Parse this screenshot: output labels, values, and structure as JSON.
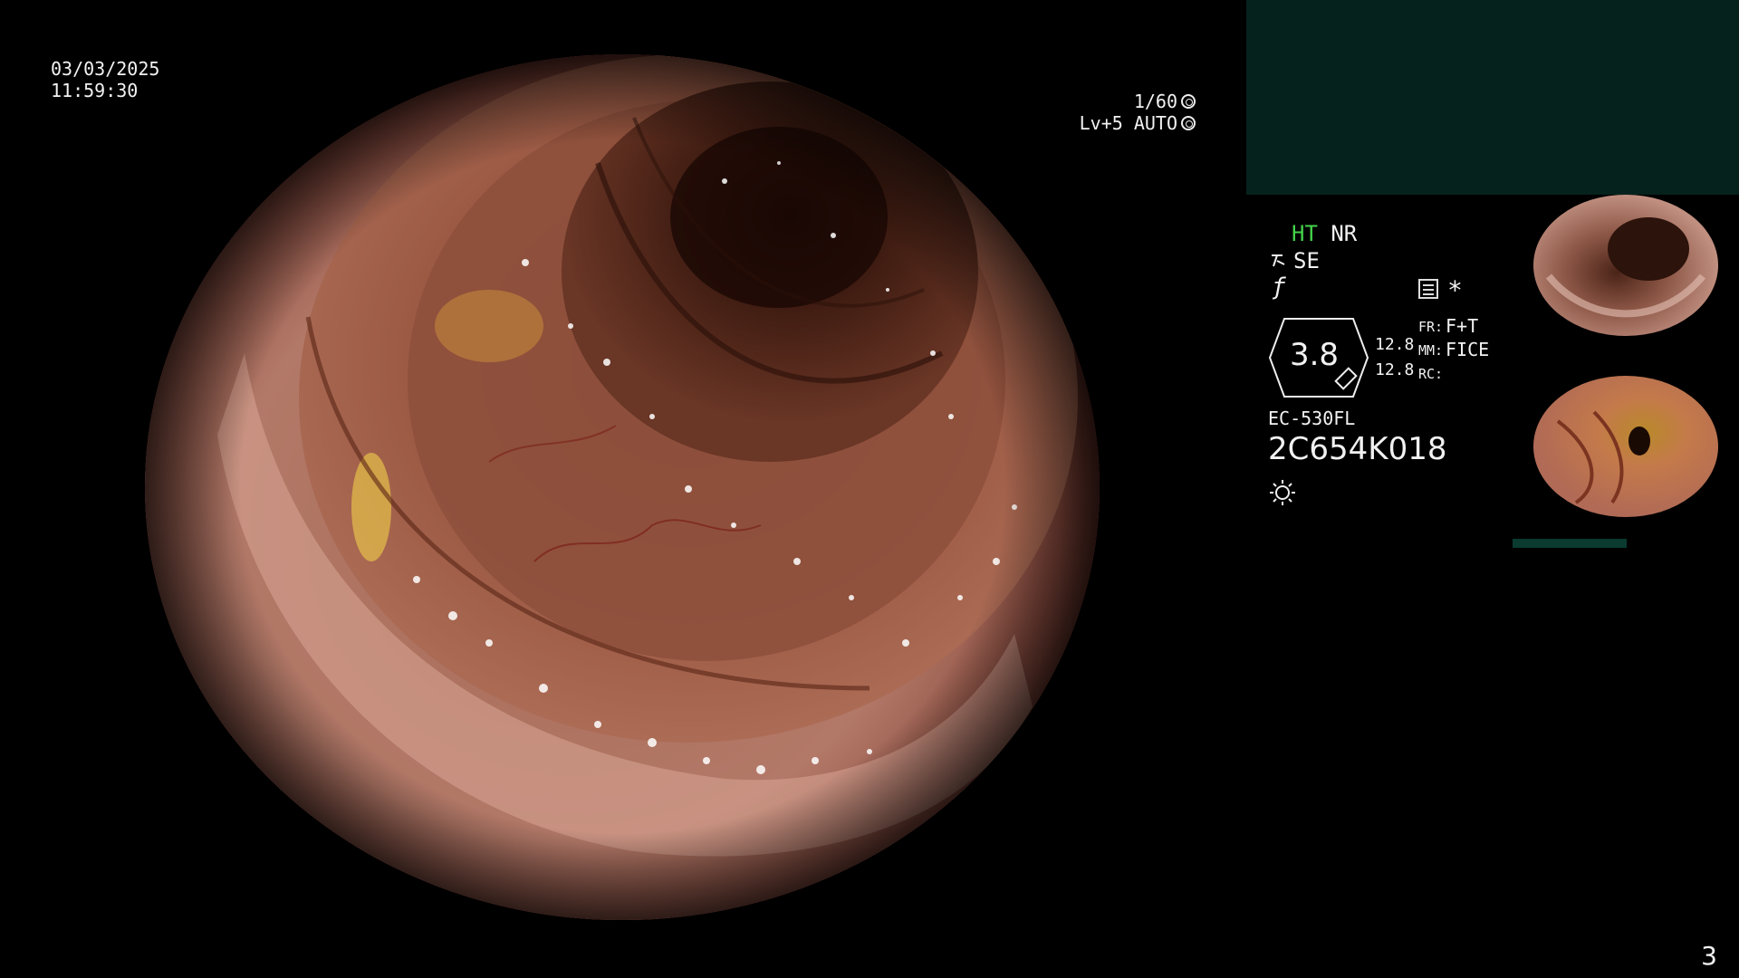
{
  "overlay": {
    "date": "03/03/2025",
    "time": "11:59:30",
    "shutter": "1/60",
    "level": "Lv+5 AUTO"
  },
  "panel": {
    "ht": "HT",
    "nr": "NR",
    "se": "SE",
    "zoom": "3.8",
    "value_1": "12.8",
    "value_2": "12.8",
    "fr_label": "FR:",
    "fr_value": "F+T",
    "mm_label": "MM:",
    "mm_value": "FICE",
    "rc_label": "RC:",
    "asterisk": "*",
    "scope_model": "EC-530FL",
    "scope_serial": "2C654K018"
  },
  "page_number": "3",
  "colors": {
    "ht_green": "#44d24a",
    "top_panel": "#06221d",
    "thumb_bar": "#0a3a30"
  },
  "icons": [
    "shutter-icon",
    "auto-iris-icon",
    "se-icon",
    "f-icon",
    "report-icon",
    "light-icon",
    "zoom-hexagon-icon"
  ]
}
